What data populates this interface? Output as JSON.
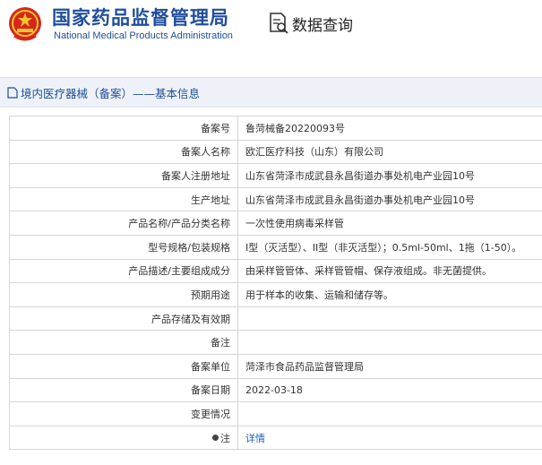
{
  "header": {
    "org_name_cn": "国家药品监督管理局",
    "org_name_en": "National Medical Products Administration",
    "query_label": "数据查询"
  },
  "breadcrumb": {
    "text": "境内医疗器械（备案）——基本信息"
  },
  "colors": {
    "brand": "#1f4e9b",
    "emblem_red": "#d7261b",
    "link": "#1f5fbf"
  },
  "rows": [
    {
      "label": "备案号",
      "value": "鲁菏械备20220093号"
    },
    {
      "label": "备案人名称",
      "value": "欧汇医疗科技（山东）有限公司"
    },
    {
      "label": "备案人注册地址",
      "value": "山东省菏泽市成武县永昌街道办事处机电产业园10号"
    },
    {
      "label": "生产地址",
      "value": "山东省菏泽市成武县永昌街道办事处机电产业园10号"
    },
    {
      "label": "产品名称/产品分类名称",
      "value": "一次性使用病毒采样管"
    },
    {
      "label": "型号规格/包装规格",
      "value": "I型（灭活型）、II型（非灭活型）；0.5ml-50ml、1拖（1-50）。"
    },
    {
      "label": "产品描述/主要组成成分",
      "value": "由采样管管体、采样管管帽、保存液组成。非无菌提供。"
    },
    {
      "label": "预期用途",
      "value": "用于样本的收集、运输和储存等。"
    },
    {
      "label": "产品存储及有效期",
      "value": ""
    },
    {
      "label": "备注",
      "value": ""
    },
    {
      "label": "备案单位",
      "value": "菏泽市食品药品监督管理局"
    },
    {
      "label": "备案日期",
      "value": "2022-03-18"
    },
    {
      "label": "变更情况",
      "value": ""
    },
    {
      "label": "注",
      "value": "详情"
    }
  ]
}
